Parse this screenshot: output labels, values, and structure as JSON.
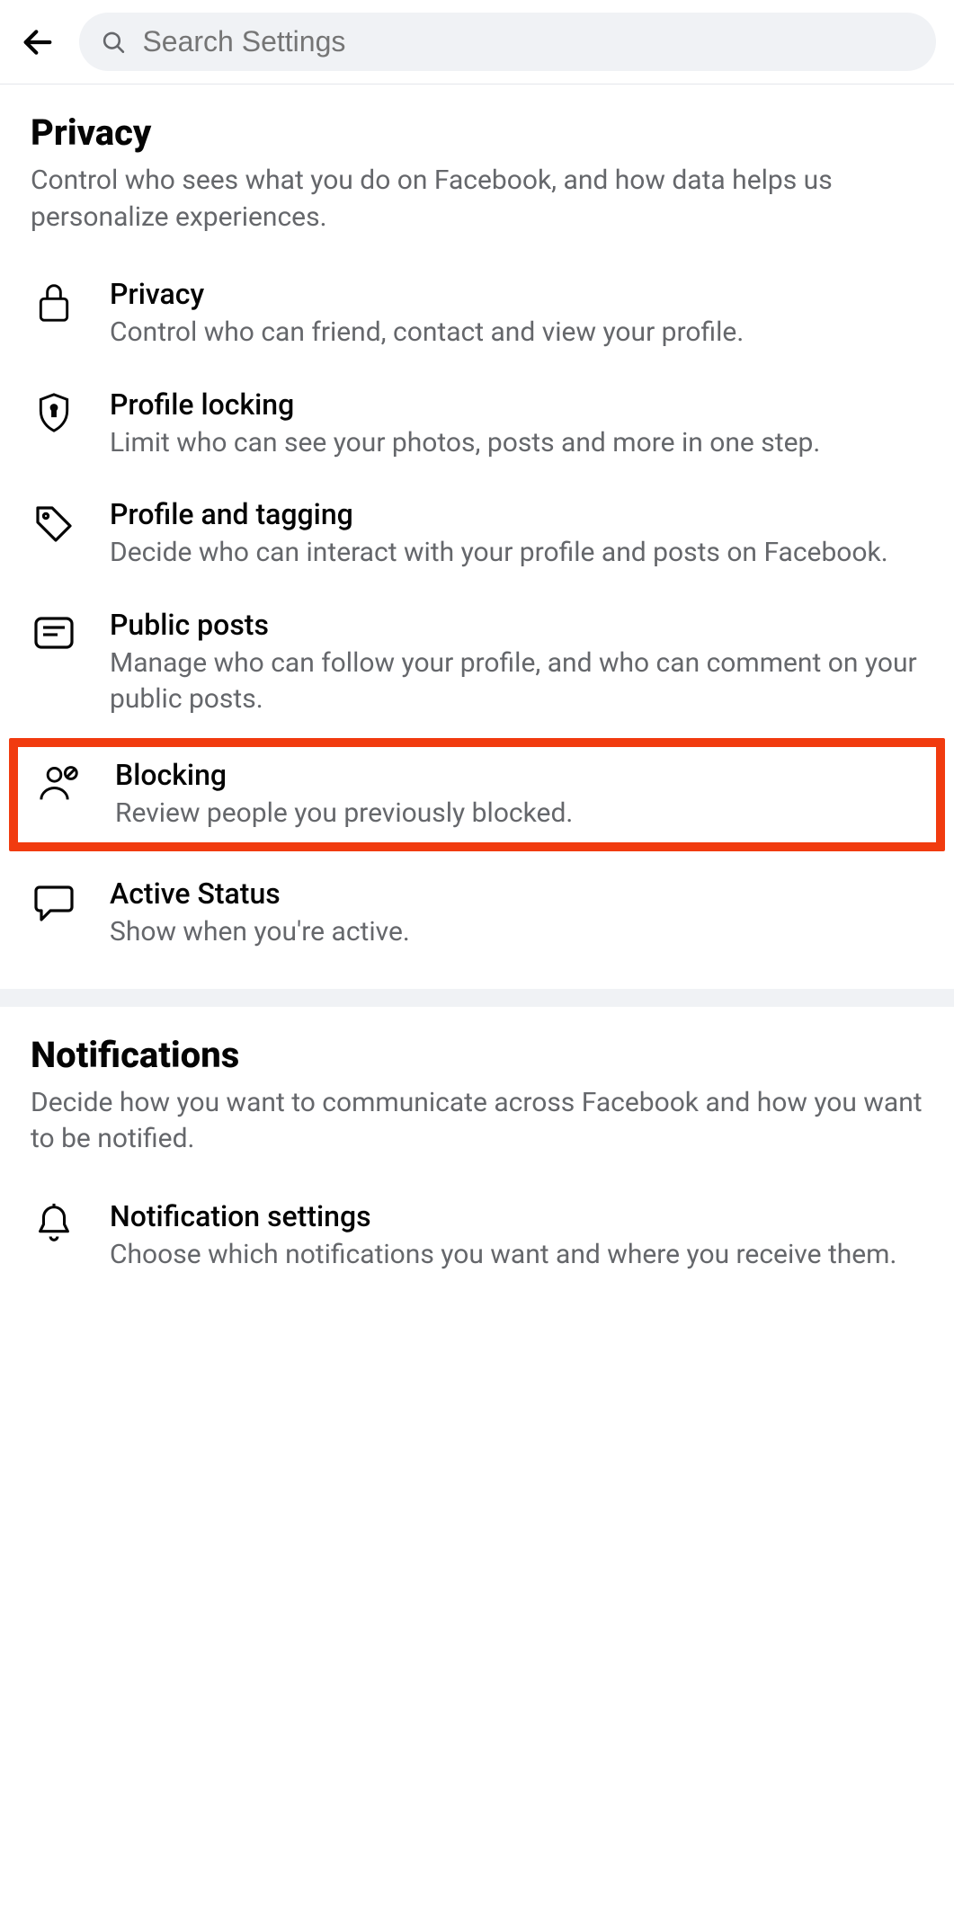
{
  "header": {
    "search_placeholder": "Search Settings"
  },
  "sections": [
    {
      "title": "Privacy",
      "subtitle": "Control who sees what you do on Facebook, and how data helps us personalize experiences.",
      "items": [
        {
          "icon": "lock",
          "title": "Privacy",
          "desc": "Control who can friend, contact and view your profile."
        },
        {
          "icon": "shield",
          "title": "Profile locking",
          "desc": "Limit who can see your photos, posts and more in one step."
        },
        {
          "icon": "tag",
          "title": "Profile and tagging",
          "desc": "Decide who can interact with your profile and posts on Facebook."
        },
        {
          "icon": "post",
          "title": "Public posts",
          "desc": "Manage who can follow your profile, and who can comment on your public posts."
        },
        {
          "icon": "block",
          "title": "Blocking",
          "desc": "Review people you previously blocked.",
          "highlight": true
        },
        {
          "icon": "chat",
          "title": "Active Status",
          "desc": "Show when you're active."
        }
      ]
    },
    {
      "title": "Notifications",
      "subtitle": "Decide how you want to communicate across Facebook and how you want to be notified.",
      "items": [
        {
          "icon": "bell",
          "title": "Notification settings",
          "desc": "Choose which notifications you want and where you receive them."
        }
      ]
    }
  ]
}
